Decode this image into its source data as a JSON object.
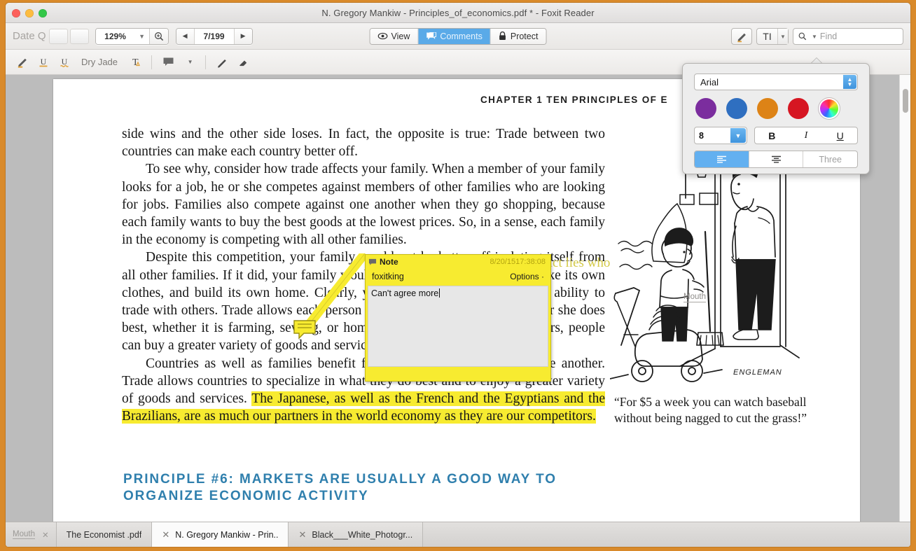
{
  "window": {
    "title": "N. Gregory Mankiw - Principles_of_economics.pdf * - Foxit Reader"
  },
  "toolbar": {
    "ghost_label": "Date Q",
    "zoom_value": "129%",
    "page_value": "7/199",
    "mode_tabs": [
      {
        "label": "View",
        "icon": "eye-icon",
        "active": false
      },
      {
        "label": "Comments",
        "icon": "comment-icon",
        "active": true
      },
      {
        "label": "Protect",
        "icon": "lock-icon",
        "active": false
      }
    ],
    "text_format_label": "TI",
    "find_placeholder": "Find"
  },
  "annotation_toolbar": {
    "highlight_label": "highlighter-icon",
    "underline_label": "U",
    "squiggly_label": "U",
    "color_name": "Dry Jade",
    "text_tool_label": "T",
    "note_label": "comment-icon",
    "pencil_label": "pencil-icon",
    "eraser_label": "eraser-icon"
  },
  "format_popup": {
    "font_name": "Arial",
    "font_size": "8",
    "bold_label": "B",
    "italic_label": "I",
    "underline_label": "U",
    "align_three_label": "Three",
    "swatches": [
      "#7b2d9e",
      "#2f6fc0",
      "#dd8316",
      "#d61622"
    ],
    "wheel_name": "color-wheel-icon"
  },
  "note_popup": {
    "title": "Note",
    "date": "8/20/1517:38:08",
    "author": "foxitking",
    "options_label": "Options",
    "body_text": "Can't agree more"
  },
  "document": {
    "chapter_header": "CHAPTER 1   TEN PRINCIPLES OF E",
    "paragraphs": [
      "side wins and the other side loses. In fact, the opposite is true: Trade between two countries can make each country better off.",
      "To see why, consider how trade affects your family. When a member of your family looks for a job, he or she competes against members of other families who are looking for jobs. Families also compete against one another when they go shopping, because each family wants to buy the best goods at the lowest prices. So, in a sense, each family in the economy is competing with all other families.",
      "Despite this competition, your family would not be better off isolating itself from all other families. If it did, your family would need to grow its own food, make its own clothes, and build its own home. Clearly, your family gains much from its ability to trade with others. Trade allows each person to specialize in the activities he or she does best, whether it is farming, sewing, or home building. By trading with others, people can buy a greater variety of goods and services at lower cost.",
      "Countries as well as families benefit from the ability to trade with one another. Trade allows countries to specialize in what they do best and to enjoy a greater variety of goods and services. The Japanese, as well as the French and the Egyptians and the Brazilians, are as much our partners in the world economy as they are our competitors."
    ],
    "highlighted_sentence": "The Japanese, as well as the French and the Egyptians and the Brazilians, are as much our partners in the world economy as they are our competitors.",
    "principle_heading": "PRINCIPLE #6: MARKETS ARE USUALLY A GOOD WAY TO ORGANIZE ECONOMIC ACTIVITY",
    "note_bleed_text": "district lies who",
    "cartoon_caption": "“For $5 a week you can watch baseball without being nagged to cut the grass!”",
    "cartoon_signature": "ENGLEMAN",
    "mouth_label": "Mouth"
  },
  "tabbar": {
    "ghost_label": "Mouth",
    "tabs": [
      {
        "label": "The Economist .pdf",
        "active": false,
        "close": "×"
      },
      {
        "label": "N. Gregory Mankiw - Prin..",
        "active": true,
        "close": "×"
      },
      {
        "label": "Black___White_Photogr...",
        "active": false,
        "close": "×"
      }
    ]
  }
}
